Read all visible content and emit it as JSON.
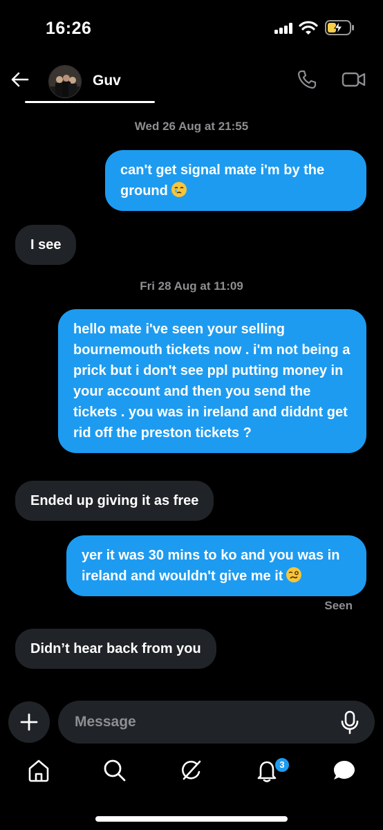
{
  "status_bar": {
    "time": "16:26"
  },
  "header": {
    "contact_name": "Guv"
  },
  "messages": [
    {
      "type": "timestamp",
      "text": "Wed 26 Aug at 21:55"
    },
    {
      "type": "sent",
      "text": "can't get signal mate i'm by the ground",
      "emoji": "face-holding-back-tears"
    },
    {
      "type": "received",
      "text": "I see"
    },
    {
      "type": "timestamp",
      "text": "Fri 28 Aug at 11:09"
    },
    {
      "type": "sent",
      "text": "hello mate i've seen your selling bournemouth tickets now . i'm not being a prick but i don't see ppl putting money in your account and then you send the tickets . you was in ireland and diddnt get rid off the preston tickets ?"
    },
    {
      "type": "received",
      "text": "Ended up giving it as free"
    },
    {
      "type": "sent",
      "text": "yer it was 30 mins to ko and you was in ireland and wouldn't give me it",
      "emoji": "woozy-face"
    },
    {
      "type": "status",
      "text": "Seen"
    },
    {
      "type": "received",
      "text": "Didn’t hear back from you"
    }
  ],
  "composer": {
    "placeholder": "Message"
  },
  "tab_bar": {
    "items": [
      "home-icon",
      "search-icon",
      "grok-icon",
      "notifications-icon",
      "messages-icon"
    ],
    "notification_count": "3"
  },
  "colors": {
    "accent": "#1d9bf0",
    "received_bubble": "#202327",
    "muted_text": "#8e8e93",
    "background": "#000000"
  }
}
